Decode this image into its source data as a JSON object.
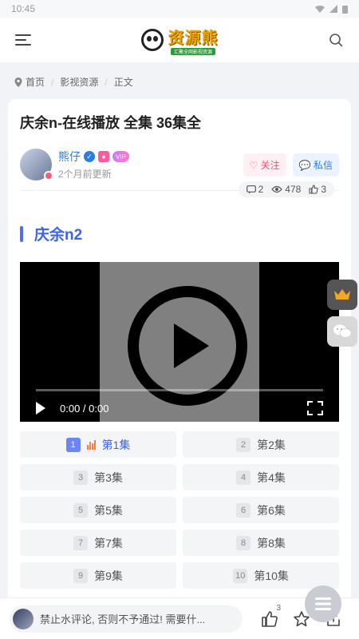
{
  "status": {
    "time": "10:45"
  },
  "header": {
    "logo_text": "资源熊",
    "logo_sub": "汇聚全网影视资源"
  },
  "breadcrumb": {
    "home": "首页",
    "category": "影视资源",
    "current": "正文"
  },
  "post": {
    "title": "庆余n-在线播放 全集 36集全",
    "author": {
      "name": "熊仔",
      "time": "2个月前更新",
      "vip": "VIP"
    },
    "follow_label": "关注",
    "message_label": "私信",
    "stats": {
      "comments": "2",
      "views": "478",
      "likes": "3"
    },
    "section_title": "庆余n2"
  },
  "player": {
    "time": "0:00 / 0:00",
    "progress": 0
  },
  "episodes": [
    {
      "num": "1",
      "label": "第1集",
      "active": true
    },
    {
      "num": "2",
      "label": "第2集"
    },
    {
      "num": "3",
      "label": "第3集"
    },
    {
      "num": "4",
      "label": "第4集"
    },
    {
      "num": "5",
      "label": "第5集"
    },
    {
      "num": "6",
      "label": "第6集"
    },
    {
      "num": "7",
      "label": "第7集"
    },
    {
      "num": "8",
      "label": "第8集"
    },
    {
      "num": "9",
      "label": "第9集"
    },
    {
      "num": "10",
      "label": "第10集"
    }
  ],
  "bottom": {
    "comment_placeholder": "禁止水评论, 否则不予通过! 需要什...",
    "like_count": "3"
  },
  "colors": {
    "accent": "#3d63e6",
    "follow": "#ff4f6d",
    "link": "#2d7ce6"
  }
}
